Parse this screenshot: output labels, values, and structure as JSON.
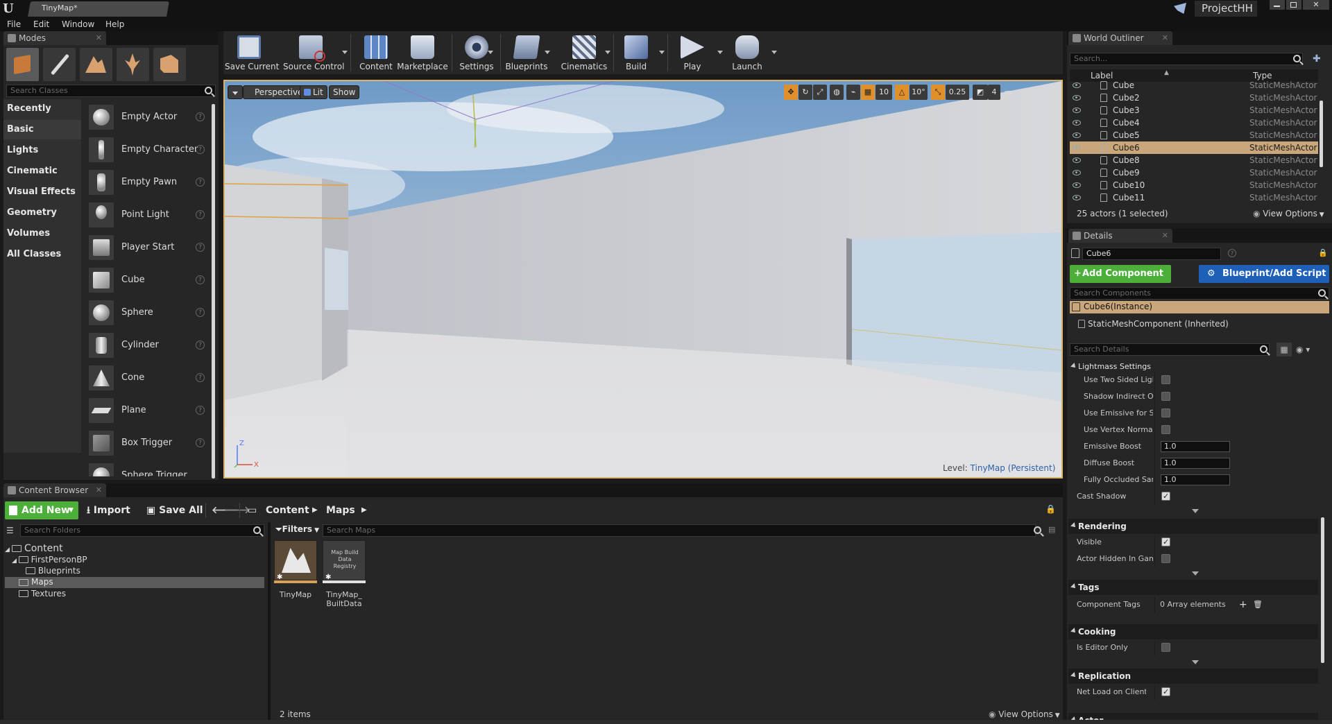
{
  "window": {
    "doc_tab": "TinyMap*",
    "project_name": "ProjectHH"
  },
  "menu": [
    "File",
    "Edit",
    "Window",
    "Help"
  ],
  "modes": {
    "tab": "Modes",
    "search_placeholder": "Search Classes",
    "categories": [
      "Recently Placed",
      "Basic",
      "Lights",
      "Cinematic",
      "Visual Effects",
      "Geometry",
      "Volumes",
      "All Classes"
    ],
    "active_category": "Basic",
    "items": [
      "Empty Actor",
      "Empty Character",
      "Empty Pawn",
      "Point Light",
      "Player Start",
      "Cube",
      "Sphere",
      "Cylinder",
      "Cone",
      "Plane",
      "Box Trigger",
      "Sphere Trigger"
    ]
  },
  "toolbar": {
    "save_current": "Save Current",
    "source_control": "Source Control",
    "content": "Content",
    "marketplace": "Marketplace",
    "settings": "Settings",
    "blueprints": "Blueprints",
    "cinematics": "Cinematics",
    "build": "Build",
    "play": "Play",
    "launch": "Launch"
  },
  "viewport": {
    "perspective": "Perspective",
    "lit": "Lit",
    "show": "Show",
    "grid_snap": "10",
    "rotation_snap": "10°",
    "scale_snap": "0.25",
    "camera_speed": "4",
    "level_label": "Level:",
    "level_name": "TinyMap (Persistent)"
  },
  "outliner": {
    "tab": "World Outliner",
    "search_placeholder": "Search...",
    "col_label": "Label",
    "col_type": "Type",
    "rows": [
      {
        "label": "Cube",
        "type": "StaticMeshActor"
      },
      {
        "label": "Cube2",
        "type": "StaticMeshActor"
      },
      {
        "label": "Cube3",
        "type": "StaticMeshActor"
      },
      {
        "label": "Cube4",
        "type": "StaticMeshActor"
      },
      {
        "label": "Cube5",
        "type": "StaticMeshActor"
      },
      {
        "label": "Cube6",
        "type": "StaticMeshActor"
      },
      {
        "label": "Cube8",
        "type": "StaticMeshActor"
      },
      {
        "label": "Cube9",
        "type": "StaticMeshActor"
      },
      {
        "label": "Cube10",
        "type": "StaticMeshActor"
      },
      {
        "label": "Cube11",
        "type": "StaticMeshActor"
      }
    ],
    "selected": "Cube6",
    "status": "25 actors (1 selected)",
    "view_options": "View Options"
  },
  "details": {
    "tab": "Details",
    "name_value": "Cube6",
    "add_component": "Add Component",
    "blueprint_script": "Blueprint/Add Script",
    "search_components": "Search Components",
    "instance": "Cube6(Instance)",
    "component": "StaticMeshComponent (Inherited)",
    "search_details": "Search Details",
    "sections": {
      "lightmass": "Lightmass Settings",
      "rendering": "Rendering",
      "tags": "Tags",
      "cooking": "Cooking",
      "replication": "Replication",
      "actor": "Actor"
    },
    "lightmass_props": [
      {
        "name": "Use Two Sided Light",
        "checked": false
      },
      {
        "name": "Shadow Indirect Onl",
        "checked": false
      },
      {
        "name": "Use Emissive for Sta",
        "checked": false
      },
      {
        "name": "Use Vertex Normal f",
        "checked": false
      }
    ],
    "emissive_boost": {
      "name": "Emissive Boost",
      "value": "1.0"
    },
    "diffuse_boost": {
      "name": "Diffuse Boost",
      "value": "1.0"
    },
    "fully_occluded": {
      "name": "Fully Occluded Sam",
      "value": "1.0"
    },
    "cast_shadow": {
      "name": "Cast Shadow",
      "checked": true
    },
    "visible": {
      "name": "Visible",
      "checked": true
    },
    "hidden_in_game": {
      "name": "Actor Hidden In Game",
      "checked": false
    },
    "component_tags": {
      "name": "Component Tags",
      "value": "0 Array elements"
    },
    "editor_only": {
      "name": "Is Editor Only",
      "checked": false
    },
    "net_load": {
      "name": "Net Load on Client",
      "checked": true
    }
  },
  "content_browser": {
    "tab": "Content Browser",
    "add_new": "Add New",
    "import": "Import",
    "save_all": "Save All",
    "breadcrumb": [
      "Content",
      "Maps"
    ],
    "search_folders": "Search Folders",
    "filters": "Filters",
    "search_maps": "Search Maps",
    "tree": {
      "root": "Content",
      "first_person": "FirstPersonBP",
      "blueprints": "Blueprints",
      "maps": "Maps",
      "textures": "Textures"
    },
    "assets": [
      {
        "name": "TinyMap",
        "thumb_text": ""
      },
      {
        "name": "TinyMap_ BuiltData",
        "thumb_text": "Map Build Data Registry"
      }
    ],
    "item_count": "2 items",
    "view_options": "View Options"
  },
  "colors": {
    "accent_green": "#4caf3a",
    "accent_blue": "#1e5fb8",
    "selection": "#c9a77a",
    "viewport_border": "#d9b36a"
  }
}
